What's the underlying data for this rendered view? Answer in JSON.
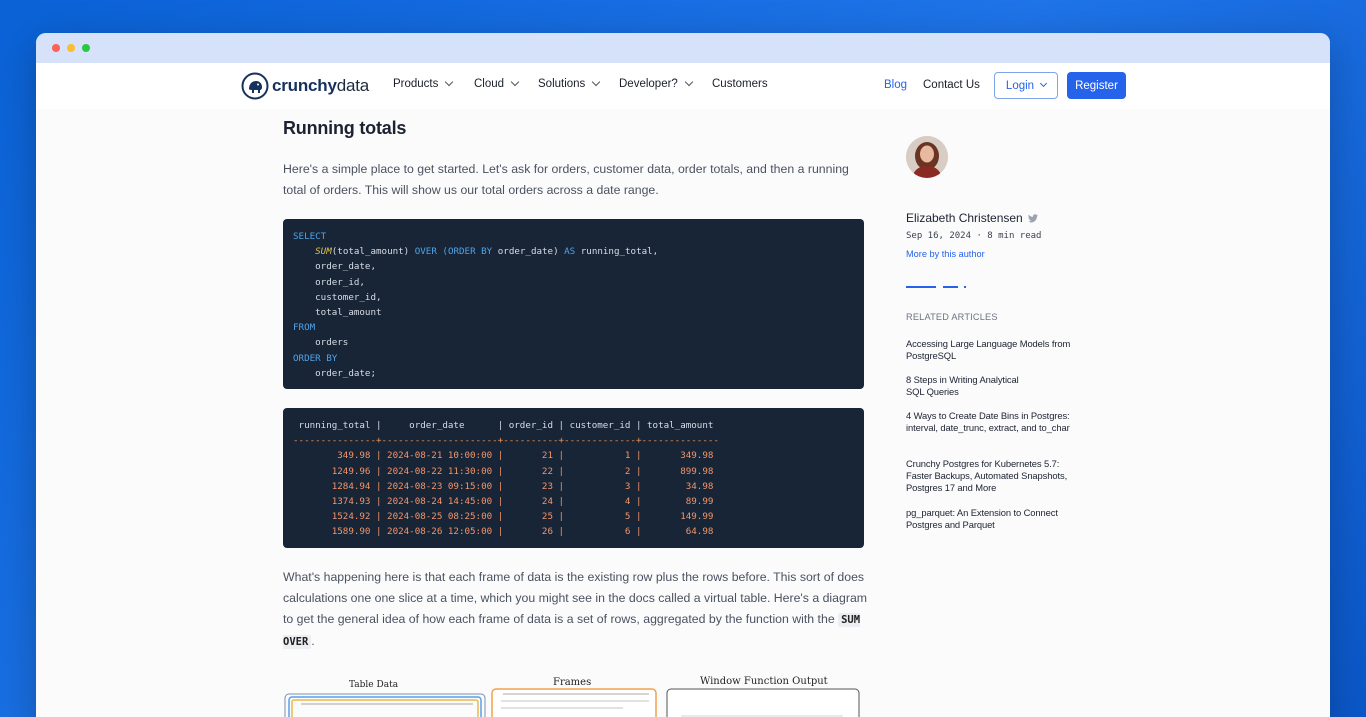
{
  "window": {
    "controls": [
      "close-dot",
      "minimize-dot",
      "maximize-dot"
    ]
  },
  "nav": {
    "logo_part1": "crunchy",
    "logo_part2": "data",
    "items": [
      {
        "label": "Products"
      },
      {
        "label": "Cloud"
      },
      {
        "label": "Solutions"
      },
      {
        "label": "Developer?"
      },
      {
        "label": "Customers"
      }
    ],
    "blog": "Blog",
    "contact": "Contact Us",
    "login": "Login",
    "register": "Register",
    "brand_color": "#2563eb"
  },
  "article": {
    "heading": "Running totals",
    "paragraph1": "Here's a simple place to get started. Let's ask for orders, customer data, order totals, and then a running total of orders. This will show us our total orders across a date range.",
    "paragraph2_text": "What's happening here is that each frame of data is the existing row plus the rows before. This sort of does calculations one one slice at a time, which you might see in the docs called a virtual table. Here's a diagram to get the general idea of how each frame of data is a set of rows, aggregated by the function with the",
    "paragraph2_code": "SUM OVER",
    "paragraph2_end": ".",
    "sql": {
      "select": "SELECT",
      "sum_fn": "SUM",
      "sum_arg": "(total_amount) ",
      "over": "OVER",
      "paren_open": " (",
      "order_by": "ORDER BY",
      "order_col": " order_date) ",
      "as": "AS",
      "alias": " running_total,",
      "cols": [
        "order_date,",
        "order_id,",
        "customer_id,",
        "total_amount"
      ],
      "from": "FROM",
      "table": "orders",
      "order_by2": "ORDER BY",
      "order_final": "order_date;"
    },
    "result": {
      "header": " running_total |     order_date      | order_id | customer_id | total_amount",
      "separator": "---------------+---------------------+----------+-------------+--------------",
      "rows": [
        "        349.98 | 2024-08-21 10:00:00 |       21 |           1 |       349.98",
        "       1249.96 | 2024-08-22 11:30:00 |       22 |           2 |       899.98",
        "       1284.94 | 2024-08-23 09:15:00 |       23 |           3 |        34.98",
        "       1374.93 | 2024-08-24 14:45:00 |       24 |           4 |        89.99",
        "       1524.92 | 2024-08-25 08:25:00 |       25 |           5 |       149.99",
        "       1589.90 | 2024-08-26 12:05:00 |       26 |           6 |        64.98"
      ]
    },
    "diagram": {
      "label_table": "Table Data",
      "label_frames": "Frames",
      "label_output": "Window Function Output"
    }
  },
  "sidebar": {
    "author": "Elizabeth Christensen",
    "meta": "Sep 16, 2024 · 8 min read",
    "more": "More by this author",
    "related_heading": "RELATED ARTICLES",
    "related": [
      "Accessing Large Language Models from PostgreSQL",
      "8 Steps in Writing Analytical SQL Queries",
      "4 Ways to Create Date Bins in Postgres: interval, date_trunc, extract, and to_char",
      "Crunchy Postgres for Kubernetes 5.7: Faster Backups, Automated Snapshots, Postgres 17 and More",
      "pg_parquet: An Extension to Connect Postgres and Parquet"
    ]
  }
}
